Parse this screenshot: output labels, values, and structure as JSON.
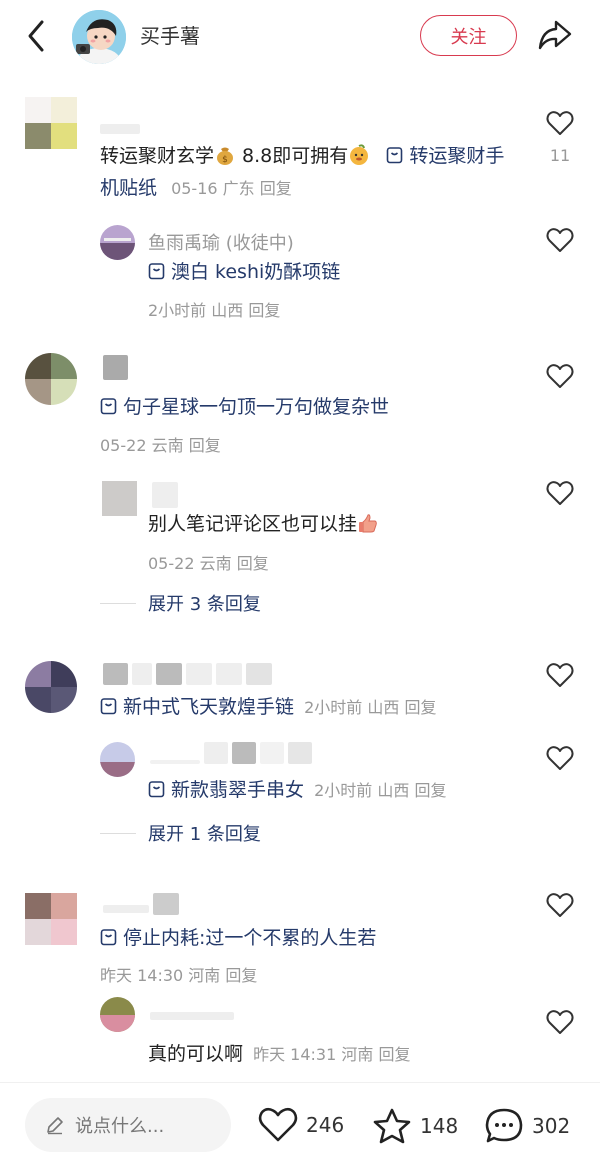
{
  "header": {
    "name": "买手薯",
    "follow_label": "关注"
  },
  "comments": [
    {
      "text_plain": "转运聚财玄学",
      "text_after_emoji": " 8.8即可拥有",
      "product": "转运聚财手机贴纸",
      "date": "05-16",
      "location": "广东",
      "reply": "回复",
      "likes": "11",
      "replies": [
        {
          "nick": "鱼雨禹瑜 (收徒中)",
          "product": "澳白 keshi奶酥项链",
          "date": "2小时前",
          "location": "山西",
          "reply": "回复"
        }
      ]
    },
    {
      "product": "句子星球一句顶一万句做复杂世",
      "date": "05-22",
      "location": "云南",
      "reply": "回复",
      "replies": [
        {
          "text": "别人笔记评论区也可以挂",
          "date": "05-22",
          "location": "云南",
          "reply": "回复"
        }
      ],
      "expand": "展开 3 条回复"
    },
    {
      "product": "新中式飞天敦煌手链",
      "date": "2小时前",
      "location": "山西",
      "reply": "回复",
      "replies": [
        {
          "product": "新款翡翠手串女",
          "date": "2小时前",
          "location": "山西",
          "reply": "回复"
        }
      ],
      "expand": "展开 1 条回复"
    },
    {
      "product": "停止内耗:过一个不累的人生若",
      "date": "昨天 14:30",
      "location": "河南",
      "reply": "回复",
      "replies": [
        {
          "text": "真的可以啊",
          "date": "昨天 14:31",
          "location": "河南",
          "reply": "回复"
        }
      ]
    }
  ],
  "bottom": {
    "placeholder": "说点什么...",
    "likes": "246",
    "stars": "148",
    "comments": "302"
  },
  "colors": {
    "accent": "#d83a4f",
    "link": "#253a6a",
    "meta": "#999999"
  }
}
